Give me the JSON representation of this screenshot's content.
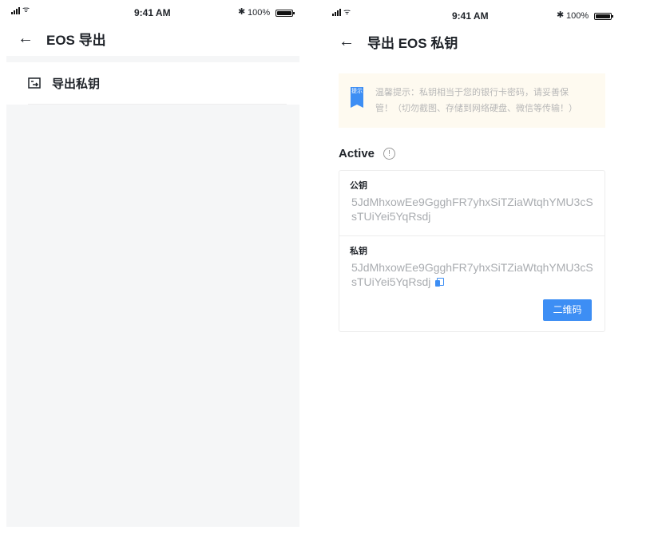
{
  "left_screen": {
    "status": {
      "time": "9:41 AM",
      "battery": "100%"
    },
    "nav": {
      "title": "EOS 导出"
    },
    "menu": {
      "export_private_key": "导出私钥"
    }
  },
  "right_screen": {
    "status": {
      "time": "9:41 AM",
      "battery": "100%"
    },
    "nav": {
      "title": "导出 EOS 私钥"
    },
    "notice": {
      "badge": "提示",
      "line1": "温馨提示：私钥相当于您的银行卡密码，请妥善保",
      "line2": "管！（切勿截图、存储到网络硬盘、微信等传输！）"
    },
    "permission": {
      "label": "Active",
      "info_glyph": "!"
    },
    "public_key": {
      "label": "公钥",
      "value": "5JdMhxowEe9GgghFR7yhxSiTZiaWtqhYMU3cSsTUiYei5YqRsdj"
    },
    "private_key": {
      "label": "私钥",
      "value": "5JdMhxowEe9GgghFR7yhxSiTZiaWtqhYMU3cSsTUiYei5YqRsdj"
    },
    "qr_button": "二维码"
  },
  "colors": {
    "accent": "#3d8ef4",
    "notice_bg": "#fefaf0",
    "page_gray": "#f5f6f7",
    "muted_text": "#a9acb0"
  },
  "icons": [
    "signal-icon",
    "wifi-icon",
    "bluetooth-icon",
    "battery-icon",
    "back-arrow-icon",
    "export-icon",
    "notice-badge-icon",
    "info-icon",
    "copy-icon"
  ]
}
